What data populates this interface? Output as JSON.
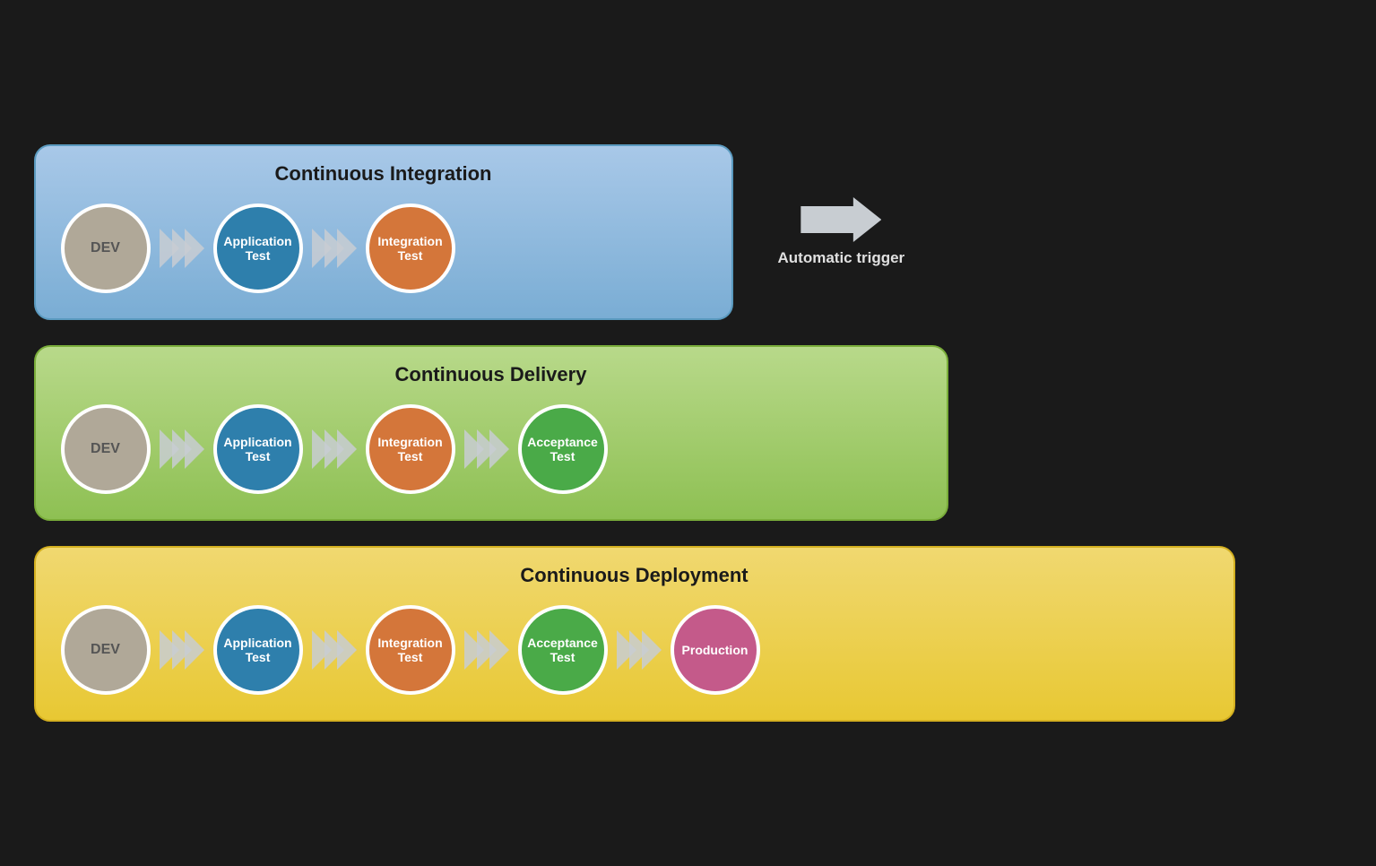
{
  "ci": {
    "title": "Continuous Integration",
    "stages": [
      {
        "id": "dev",
        "label": "DEV",
        "color": "dev"
      },
      {
        "id": "app-test",
        "label": "Application\nTest",
        "color": "app"
      },
      {
        "id": "int-test",
        "label": "Integration\nTest",
        "color": "int"
      }
    ]
  },
  "cd": {
    "title": "Continuous Delivery",
    "stages": [
      {
        "id": "dev",
        "label": "DEV",
        "color": "dev"
      },
      {
        "id": "app-test",
        "label": "Application\nTest",
        "color": "app"
      },
      {
        "id": "int-test",
        "label": "Integration\nTest",
        "color": "int"
      },
      {
        "id": "acc-test",
        "label": "Acceptance\nTest",
        "color": "acc"
      }
    ]
  },
  "cdeploy": {
    "title": "Continuous Deployment",
    "stages": [
      {
        "id": "dev",
        "label": "DEV",
        "color": "dev"
      },
      {
        "id": "app-test",
        "label": "Application\nTest",
        "color": "app"
      },
      {
        "id": "int-test",
        "label": "Integration\nTest",
        "color": "int"
      },
      {
        "id": "acc-test",
        "label": "Acceptance\nTest",
        "color": "acc"
      },
      {
        "id": "prod",
        "label": "Production",
        "color": "prod"
      }
    ]
  },
  "auto_trigger": {
    "label": "Automatic trigger"
  }
}
